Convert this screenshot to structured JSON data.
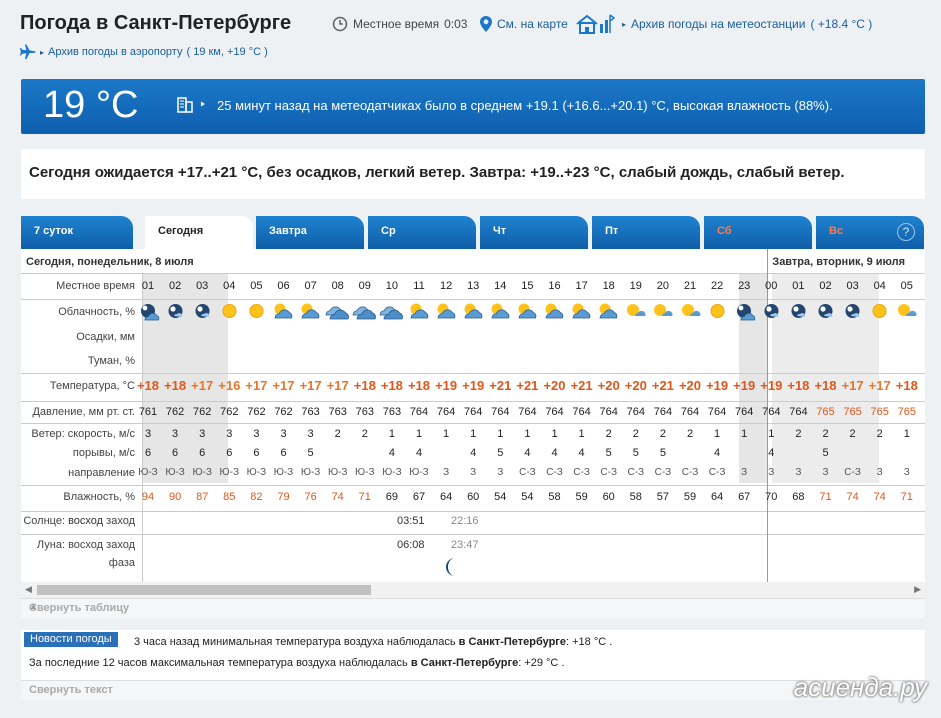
{
  "header": {
    "title": "Погода в Санкт-Петербурге",
    "local_time_label": "Местное время",
    "local_time": "0:03",
    "map_link": "См. на карте",
    "archive_station_link": "Архив погоды на метеостанции",
    "archive_station_value": "( +18.4 °C )",
    "archive_airport_link": "Архив погоды в аэропорту",
    "archive_airport_value": "( 19 км, +19 °C )"
  },
  "current": {
    "temp": "19 °C",
    "description": "25 минут назад на метеодатчиках было в среднем +19.1 (+16.6...+20.1) °C, высокая влажность (88%)."
  },
  "summary": "Сегодня ожидается +17..+21 °C, без осадков, легкий ветер. Завтра: +19..+23 °C, слабый дождь, слабый ветер.",
  "tabs": [
    {
      "label": "7 суток",
      "active": false,
      "weekend": false
    },
    {
      "label": "Сегодня",
      "active": true,
      "weekend": false
    },
    {
      "label": "Завтра",
      "active": false,
      "weekend": false
    },
    {
      "label": "Ср",
      "active": false,
      "weekend": false
    },
    {
      "label": "Чт",
      "active": false,
      "weekend": false
    },
    {
      "label": "Пт",
      "active": false,
      "weekend": false
    },
    {
      "label": "Сб",
      "active": false,
      "weekend": true
    },
    {
      "label": "Вс",
      "active": false,
      "weekend": true
    }
  ],
  "help_label": "?",
  "table": {
    "day1_header": "Сегодня, понедельник, 8 июля",
    "day2_header": "Завтра, вторник, 9 июля",
    "row_labels": {
      "time": "Местное время",
      "cloud": "Облачность, %",
      "precip": "Осадки, мм",
      "fog": "Туман, %",
      "temp": "Температура, °C",
      "pressure": "Давление, мм рт. ст.",
      "wind_speed": "Ветер: скорость, м/с",
      "gusts": "порывы, м/с",
      "direction": "направление",
      "humidity": "Влажность, %",
      "sun_prefix": "Солнце:",
      "sun_rise": "восход",
      "sun_set": "заход",
      "moon_prefix": "Луна:",
      "moon_rise": "восход",
      "moon_set": "заход",
      "phase": "фаза"
    },
    "hours": [
      "01",
      "02",
      "03",
      "04",
      "05",
      "06",
      "07",
      "08",
      "09",
      "10",
      "11",
      "12",
      "13",
      "14",
      "15",
      "16",
      "17",
      "18",
      "19",
      "20",
      "21",
      "22",
      "23",
      "00",
      "01",
      "02",
      "03",
      "04",
      "05"
    ],
    "cloud_icons": [
      "night-cloudy",
      "night-partly",
      "night-partly",
      "sun",
      "sun",
      "sun-cloud",
      "sun-cloud",
      "cloudy",
      "cloudy",
      "cloudy",
      "sun-cloud",
      "sun-cloud",
      "sun-cloud",
      "sun-cloud",
      "sun-cloud",
      "sun-cloud",
      "sun-cloud",
      "sun-cloud",
      "sun-small-cloud",
      "sun-small-cloud",
      "sun-small-cloud",
      "sun",
      "night-cloudy",
      "night-partly",
      "night-partly",
      "night-partly",
      "night-partly",
      "sun",
      "sun-small-cloud"
    ],
    "temps": [
      "+18",
      "+18",
      "+17",
      "+16",
      "+17",
      "+17",
      "+17",
      "+17",
      "+18",
      "+18",
      "+18",
      "+19",
      "+19",
      "+21",
      "+21",
      "+20",
      "+21",
      "+20",
      "+20",
      "+21",
      "+20",
      "+19",
      "+19",
      "+19",
      "+18",
      "+18",
      "+17",
      "+17",
      "+18"
    ],
    "pressure": [
      "761",
      "762",
      "762",
      "762",
      "762",
      "762",
      "763",
      "763",
      "763",
      "763",
      "764",
      "764",
      "764",
      "764",
      "764",
      "764",
      "764",
      "764",
      "764",
      "764",
      "764",
      "764",
      "764",
      "764",
      "764",
      "765",
      "765",
      "765",
      "765"
    ],
    "wind_speed": [
      "3",
      "3",
      "3",
      "3",
      "3",
      "3",
      "3",
      "2",
      "2",
      "1",
      "1",
      "1",
      "1",
      "1",
      "1",
      "1",
      "1",
      "2",
      "2",
      "2",
      "2",
      "1",
      "1",
      "1",
      "2",
      "2",
      "2",
      "2",
      "1"
    ],
    "gusts": [
      "6",
      "6",
      "6",
      "6",
      "6",
      "6",
      "5",
      "",
      "",
      "4",
      "4",
      "",
      "4",
      "5",
      "4",
      "4",
      "4",
      "5",
      "5",
      "5",
      "",
      "4",
      "",
      "4",
      "",
      "5",
      "",
      "",
      ""
    ],
    "directions": [
      "Ю-З",
      "Ю-З",
      "Ю-З",
      "Ю-З",
      "Ю-З",
      "Ю-З",
      "Ю-З",
      "Ю-З",
      "Ю-З",
      "Ю-З",
      "Ю-З",
      "З",
      "З",
      "З",
      "С-З",
      "С-З",
      "С-З",
      "С-З",
      "С-З",
      "С-З",
      "С-З",
      "С-З",
      "З",
      "З",
      "З",
      "З",
      "С-З",
      "З",
      "З"
    ],
    "humidity": [
      "94",
      "90",
      "87",
      "85",
      "82",
      "79",
      "76",
      "74",
      "71",
      "69",
      "67",
      "64",
      "60",
      "54",
      "54",
      "58",
      "59",
      "60",
      "58",
      "57",
      "59",
      "64",
      "67",
      "70",
      "68",
      "71",
      "74",
      "74",
      "71"
    ],
    "sunrise": "03:51",
    "sunset": "22:16",
    "moonrise": "06:08",
    "moonset": "23:47"
  },
  "collapse_table": "Свернуть таблицу",
  "news": {
    "label": "Новости погоды",
    "line1_pre": "3 часа назад минимальная температура воздуха наблюдалась",
    "line1_city": "в Санкт-Петербурге",
    "line1_value": ": +18 °C .",
    "line2_pre": "За последние 12 часов максимальная температура воздуха наблюдалась",
    "line2_city": "в Санкт-Петербурге",
    "line2_value": ": +29 °C ."
  },
  "collapse_text": "Свернуть текст",
  "watermark": "асиенда.ру",
  "colors": {
    "accent": "#1b78c8",
    "temp": "#e1561a",
    "weekend": "#ff7b4a"
  }
}
